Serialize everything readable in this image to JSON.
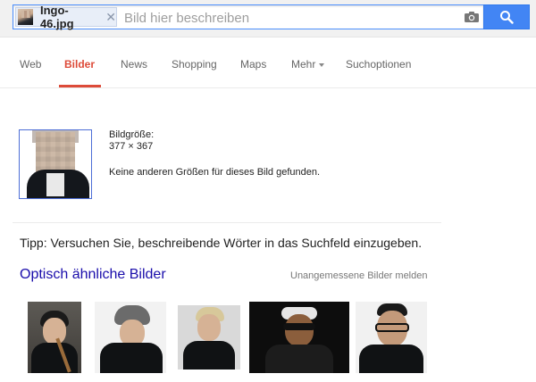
{
  "search": {
    "chip_label": "Ingo-46.jpg",
    "chip_close": "✕",
    "placeholder": "Bild hier beschreiben",
    "camera_icon": "camera-icon",
    "button_icon": "search-icon"
  },
  "nav": {
    "items": [
      {
        "label": "Web"
      },
      {
        "label": "Bilder",
        "active": true
      },
      {
        "label": "News"
      },
      {
        "label": "Shopping"
      },
      {
        "label": "Maps"
      },
      {
        "label": "Mehr"
      },
      {
        "label": "Suchoptionen"
      }
    ]
  },
  "result": {
    "size_label": "Bildgröße:",
    "size_value": "377 × 367",
    "no_other_sizes": "Keine anderen Größen für dieses Bild gefunden."
  },
  "tip": "Tipp: Versuchen Sie, beschreibende Wörter in das Suchfeld einzugeben.",
  "similar": {
    "title": "Optisch ähnliche Bilder",
    "report_link": "Unangemessene Bilder melden",
    "thumbnails": 5
  },
  "colors": {
    "accent_red": "#dd4b39",
    "link_blue": "#1a0dab",
    "search_blue": "#4285f4"
  }
}
